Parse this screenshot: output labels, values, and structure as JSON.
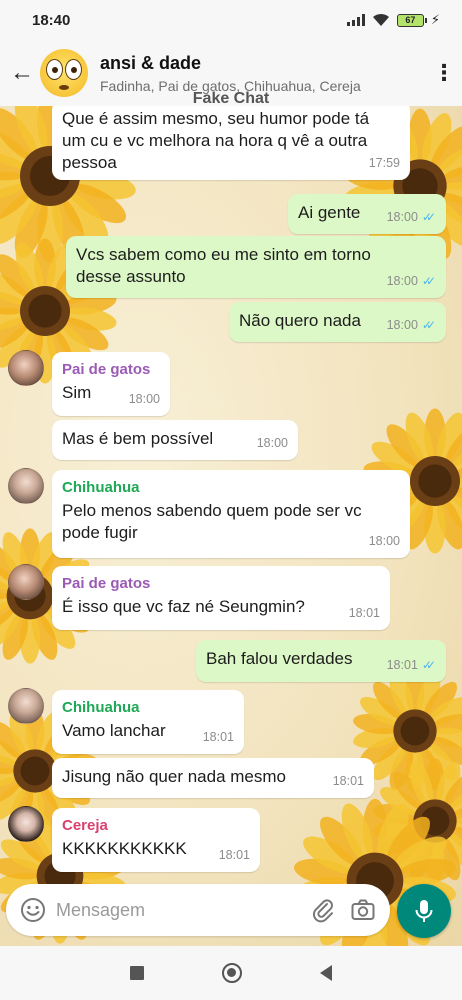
{
  "status_bar": {
    "time": "18:40",
    "battery": "67",
    "charge_icon": "⚡"
  },
  "header": {
    "back_icon": "←",
    "group_name": "ansi & dade",
    "members": "Fadinha, Pai de gatos, Chihuahua, Cereja",
    "menu_icon": "⋮"
  },
  "watermark": "Fake Chat",
  "messages": [
    {
      "direction": "in",
      "sender": "",
      "text": "Que é assim mesmo, seu humor pode tá um cu e vc melhora na hora q vê a outra pessoa",
      "time": "17:59"
    },
    {
      "direction": "out",
      "text": "Ai gente",
      "time": "18:00"
    },
    {
      "direction": "out",
      "text": "Vcs sabem como eu me sinto em torno desse assunto",
      "time": "18:00"
    },
    {
      "direction": "out",
      "text": "Não quero nada",
      "time": "18:00"
    },
    {
      "direction": "in",
      "sender": "Pai de gatos",
      "text": "Sim",
      "time": "18:00"
    },
    {
      "direction": "in",
      "sender": "",
      "text": "Mas é bem possível",
      "time": "18:00"
    },
    {
      "direction": "in",
      "sender": "Chihuahua",
      "text": "Pelo menos sabendo quem pode ser vc pode fugir",
      "time": "18:00"
    },
    {
      "direction": "in",
      "sender": "Pai de gatos",
      "text": "É isso que vc faz né Seungmin?",
      "time": "18:01"
    },
    {
      "direction": "out",
      "text": "Bah falou verdades",
      "time": "18:01"
    },
    {
      "direction": "in",
      "sender": "Chihuahua",
      "text": "Vamo lanchar",
      "time": "18:01"
    },
    {
      "direction": "in",
      "sender": "",
      "text": "Jisung não quer nada mesmo",
      "time": "18:01"
    },
    {
      "direction": "in",
      "sender": "Cereja",
      "text": "KKKKKKKKKKK",
      "time": "18:01"
    }
  ],
  "input": {
    "placeholder": "Mensagem"
  },
  "icons": {
    "back": "back-arrow-icon",
    "menu": "more-vert-icon",
    "emoji": "emoji-icon",
    "attach": "paperclip-icon",
    "camera": "camera-icon",
    "mic": "mic-icon",
    "read_ticks": "double-check-icon"
  },
  "colors": {
    "out_bubble": "#dcf8c6",
    "in_bubble": "#ffffff",
    "accent": "#00897b",
    "read_tick": "#4fb6ec",
    "sender_pai_de_gatos": "#9b5bb5",
    "sender_chihuahua": "#1fa855",
    "sender_cereja": "#d9406e"
  }
}
